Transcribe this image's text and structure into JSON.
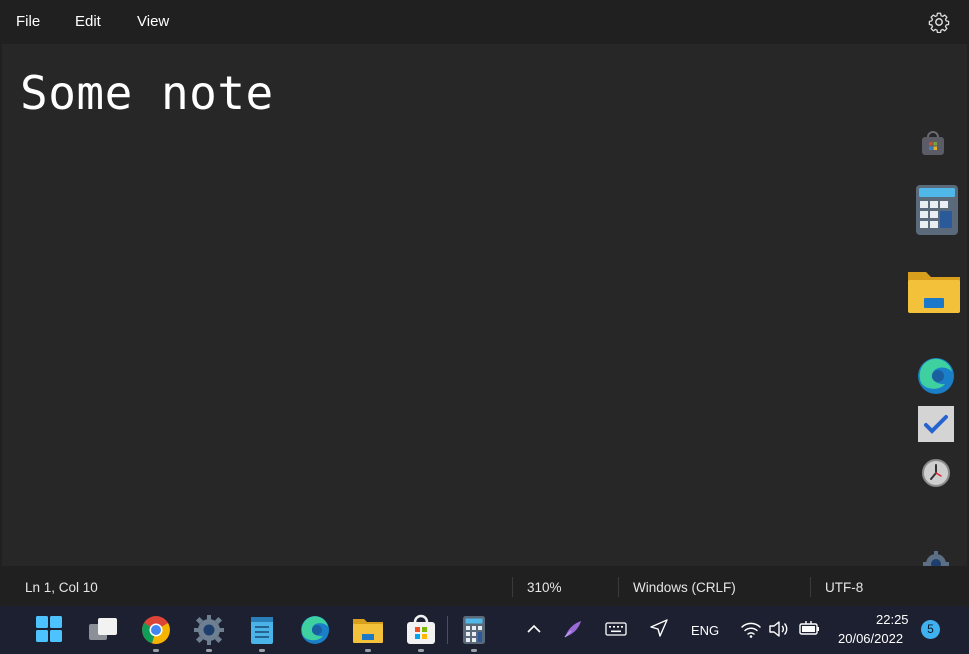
{
  "menu": {
    "file": "File",
    "edit": "Edit",
    "view": "View"
  },
  "editor": {
    "content": "Some note"
  },
  "status": {
    "position": "Ln 1, Col 10",
    "zoom": "310%",
    "line_ending": "Windows (CRLF)",
    "encoding": "UTF-8"
  },
  "tray": {
    "language": "ENG",
    "time": "22:25",
    "date": "20/06/2022",
    "notification_count": "5"
  },
  "icons": {
    "settings": "gear-icon",
    "taskbar": [
      "windows-start-icon",
      "task-view-icon",
      "chrome-icon",
      "settings-icon",
      "notepad-icon",
      "edge-icon",
      "file-explorer-icon",
      "microsoft-store-icon",
      "calculator-icon"
    ],
    "tray": [
      "chevron-up-icon",
      "pen-icon",
      "keyboard-icon",
      "location-icon",
      "wifi-icon",
      "volume-icon",
      "battery-icon"
    ],
    "desktop": [
      "store-icon",
      "calculator-icon",
      "folder-icon",
      "edge-icon",
      "todo-icon",
      "clock-icon",
      "settings-icon"
    ]
  },
  "colors": {
    "accent": "#0078d4",
    "taskbar_bg": "#1c2030",
    "editor_bg": "#272727"
  }
}
